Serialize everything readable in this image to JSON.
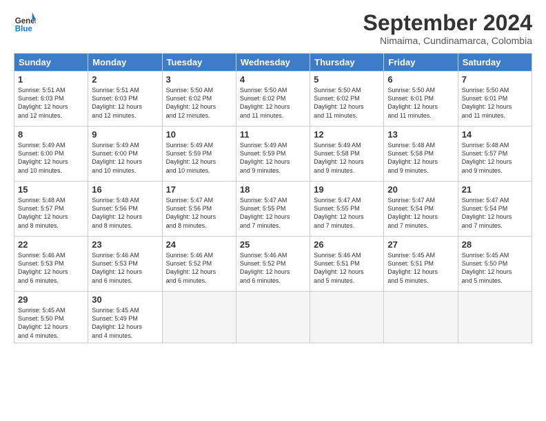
{
  "header": {
    "logo_line1": "General",
    "logo_line2": "Blue",
    "month_title": "September 2024",
    "location": "Nimaima, Cundinamarca, Colombia"
  },
  "weekdays": [
    "Sunday",
    "Monday",
    "Tuesday",
    "Wednesday",
    "Thursday",
    "Friday",
    "Saturday"
  ],
  "weeks": [
    [
      {
        "day": "1",
        "info": "Sunrise: 5:51 AM\nSunset: 6:03 PM\nDaylight: 12 hours\nand 12 minutes."
      },
      {
        "day": "2",
        "info": "Sunrise: 5:51 AM\nSunset: 6:03 PM\nDaylight: 12 hours\nand 12 minutes."
      },
      {
        "day": "3",
        "info": "Sunrise: 5:50 AM\nSunset: 6:02 PM\nDaylight: 12 hours\nand 12 minutes."
      },
      {
        "day": "4",
        "info": "Sunrise: 5:50 AM\nSunset: 6:02 PM\nDaylight: 12 hours\nand 11 minutes."
      },
      {
        "day": "5",
        "info": "Sunrise: 5:50 AM\nSunset: 6:02 PM\nDaylight: 12 hours\nand 11 minutes."
      },
      {
        "day": "6",
        "info": "Sunrise: 5:50 AM\nSunset: 6:01 PM\nDaylight: 12 hours\nand 11 minutes."
      },
      {
        "day": "7",
        "info": "Sunrise: 5:50 AM\nSunset: 6:01 PM\nDaylight: 12 hours\nand 11 minutes."
      }
    ],
    [
      {
        "day": "8",
        "info": "Sunrise: 5:49 AM\nSunset: 6:00 PM\nDaylight: 12 hours\nand 10 minutes."
      },
      {
        "day": "9",
        "info": "Sunrise: 5:49 AM\nSunset: 6:00 PM\nDaylight: 12 hours\nand 10 minutes."
      },
      {
        "day": "10",
        "info": "Sunrise: 5:49 AM\nSunset: 5:59 PM\nDaylight: 12 hours\nand 10 minutes."
      },
      {
        "day": "11",
        "info": "Sunrise: 5:49 AM\nSunset: 5:59 PM\nDaylight: 12 hours\nand 9 minutes."
      },
      {
        "day": "12",
        "info": "Sunrise: 5:49 AM\nSunset: 5:58 PM\nDaylight: 12 hours\nand 9 minutes."
      },
      {
        "day": "13",
        "info": "Sunrise: 5:48 AM\nSunset: 5:58 PM\nDaylight: 12 hours\nand 9 minutes."
      },
      {
        "day": "14",
        "info": "Sunrise: 5:48 AM\nSunset: 5:57 PM\nDaylight: 12 hours\nand 9 minutes."
      }
    ],
    [
      {
        "day": "15",
        "info": "Sunrise: 5:48 AM\nSunset: 5:57 PM\nDaylight: 12 hours\nand 8 minutes."
      },
      {
        "day": "16",
        "info": "Sunrise: 5:48 AM\nSunset: 5:56 PM\nDaylight: 12 hours\nand 8 minutes."
      },
      {
        "day": "17",
        "info": "Sunrise: 5:47 AM\nSunset: 5:56 PM\nDaylight: 12 hours\nand 8 minutes."
      },
      {
        "day": "18",
        "info": "Sunrise: 5:47 AM\nSunset: 5:55 PM\nDaylight: 12 hours\nand 7 minutes."
      },
      {
        "day": "19",
        "info": "Sunrise: 5:47 AM\nSunset: 5:55 PM\nDaylight: 12 hours\nand 7 minutes."
      },
      {
        "day": "20",
        "info": "Sunrise: 5:47 AM\nSunset: 5:54 PM\nDaylight: 12 hours\nand 7 minutes."
      },
      {
        "day": "21",
        "info": "Sunrise: 5:47 AM\nSunset: 5:54 PM\nDaylight: 12 hours\nand 7 minutes."
      }
    ],
    [
      {
        "day": "22",
        "info": "Sunrise: 5:46 AM\nSunset: 5:53 PM\nDaylight: 12 hours\nand 6 minutes."
      },
      {
        "day": "23",
        "info": "Sunrise: 5:46 AM\nSunset: 5:53 PM\nDaylight: 12 hours\nand 6 minutes."
      },
      {
        "day": "24",
        "info": "Sunrise: 5:46 AM\nSunset: 5:52 PM\nDaylight: 12 hours\nand 6 minutes."
      },
      {
        "day": "25",
        "info": "Sunrise: 5:46 AM\nSunset: 5:52 PM\nDaylight: 12 hours\nand 6 minutes."
      },
      {
        "day": "26",
        "info": "Sunrise: 5:46 AM\nSunset: 5:51 PM\nDaylight: 12 hours\nand 5 minutes."
      },
      {
        "day": "27",
        "info": "Sunrise: 5:45 AM\nSunset: 5:51 PM\nDaylight: 12 hours\nand 5 minutes."
      },
      {
        "day": "28",
        "info": "Sunrise: 5:45 AM\nSunset: 5:50 PM\nDaylight: 12 hours\nand 5 minutes."
      }
    ],
    [
      {
        "day": "29",
        "info": "Sunrise: 5:45 AM\nSunset: 5:50 PM\nDaylight: 12 hours\nand 4 minutes."
      },
      {
        "day": "30",
        "info": "Sunrise: 5:45 AM\nSunset: 5:49 PM\nDaylight: 12 hours\nand 4 minutes."
      },
      {
        "day": "",
        "info": ""
      },
      {
        "day": "",
        "info": ""
      },
      {
        "day": "",
        "info": ""
      },
      {
        "day": "",
        "info": ""
      },
      {
        "day": "",
        "info": ""
      }
    ]
  ]
}
